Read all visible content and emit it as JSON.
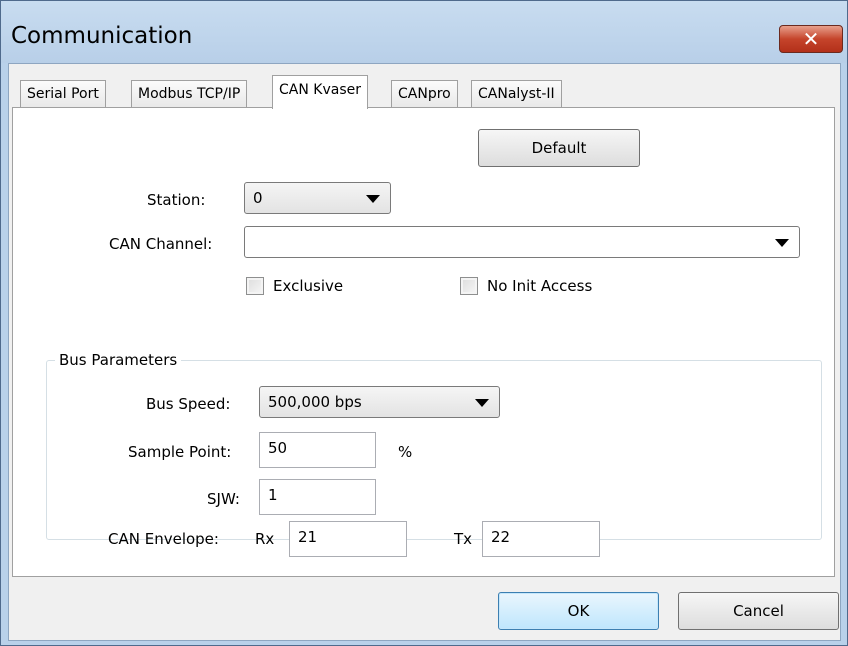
{
  "window": {
    "title": "Communication",
    "close_glyph": "✕",
    "close_icon": "close-icon"
  },
  "tabs": [
    {
      "label": "Serial Port",
      "active": false
    },
    {
      "label": "Modbus TCP/IP",
      "active": false
    },
    {
      "label": "CAN Kvaser",
      "active": true
    },
    {
      "label": "CANpro",
      "active": false
    },
    {
      "label": "CANalyst-II",
      "active": false
    }
  ],
  "panel": {
    "default_label": "Default",
    "station_label": "Station:",
    "station_value": "0",
    "channel_label": "CAN Channel:",
    "channel_value": "",
    "exclusive_label": "Exclusive",
    "exclusive_checked": false,
    "no_init_label": "No Init Access",
    "no_init_checked": false,
    "bus_params": {
      "title": "Bus Parameters",
      "speed_label": "Bus Speed:",
      "speed_value": "500,000 bps",
      "sample_label": "Sample Point:",
      "sample_value": "50",
      "sample_unit": "%",
      "sjw_label": "SJW:",
      "sjw_value": "1"
    },
    "envelope": {
      "label": "CAN Envelope:",
      "rx_label": "Rx",
      "rx_value": "21",
      "tx_label": "Tx",
      "tx_value": "22"
    }
  },
  "footer": {
    "ok_label": "OK",
    "cancel_label": "Cancel"
  },
  "colors": {
    "titlebar": "#b9d1ea",
    "close_button": "#c5442b",
    "dialog_bg": "#f0f0f0",
    "focused_button": "#bee6fd"
  }
}
